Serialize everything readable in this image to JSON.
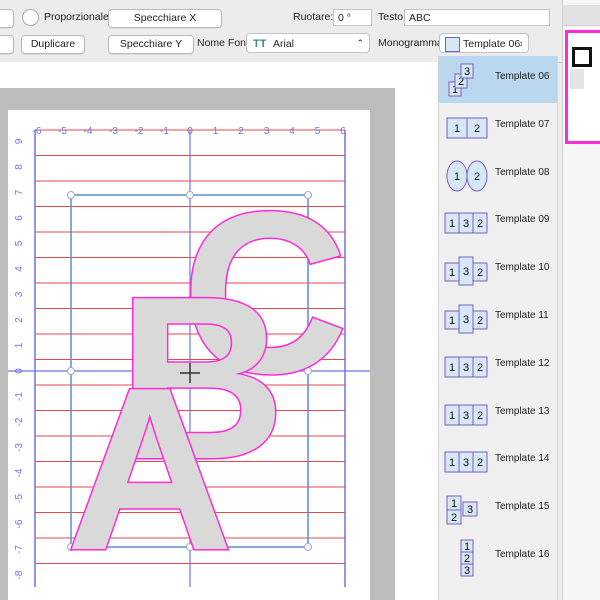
{
  "toolbar": {
    "proportional_label": "Proporzionale",
    "mirror_x_label": "Specchiare X",
    "rotate_label": "Ruotare:",
    "rotate_value": "0 °",
    "text_label": "Testo",
    "text_value": "ABC",
    "duplicate_label": "Duplicare",
    "mirror_y_label": "Specchiare Y",
    "font_label": "Nome Font",
    "font_value": "Arial",
    "monogram_label": "Monogramma",
    "monogram_value": "Template 06"
  },
  "ruler": {
    "x_ticks": [
      "-6",
      "-5",
      "-4",
      "-3",
      "-2",
      "-1",
      "0",
      "1",
      "2",
      "3",
      "4",
      "5",
      "6"
    ],
    "y_ticks": [
      "9",
      "8",
      "7",
      "6",
      "5",
      "4",
      "3",
      "2",
      "1",
      "0",
      "-1",
      "-2",
      "-3",
      "-4",
      "-5",
      "-6",
      "-7",
      "-8"
    ]
  },
  "monogram_letters": {
    "a": "A",
    "b": "B",
    "c": "C"
  },
  "templates": [
    {
      "label": "Template 06",
      "icon": "stacked-diagonal-icon",
      "glyphs": [
        "1",
        "2",
        "3"
      ],
      "selected": true
    },
    {
      "label": "Template 07",
      "icon": "hourglass-pair-icon",
      "glyphs": [
        "1",
        "2"
      ]
    },
    {
      "label": "Template 08",
      "icon": "oval-pair-icon",
      "glyphs": [
        "1",
        "2"
      ]
    },
    {
      "label": "Template 09",
      "icon": "triple-box-icon",
      "glyphs": [
        "1",
        "3",
        "2"
      ]
    },
    {
      "label": "Template 10",
      "icon": "triple-center-tall-icon",
      "glyphs": [
        "1",
        "3",
        "2"
      ]
    },
    {
      "label": "Template 11",
      "icon": "triple-center-tall-icon",
      "glyphs": [
        "1",
        "3",
        "2"
      ]
    },
    {
      "label": "Template 12",
      "icon": "triple-bracket-icon",
      "glyphs": [
        "1",
        "3",
        "2"
      ]
    },
    {
      "label": "Template 13",
      "icon": "triple-diamond-icon",
      "glyphs": [
        "1",
        "3",
        "2"
      ]
    },
    {
      "label": "Template 14",
      "icon": "triple-arrow-icon",
      "glyphs": [
        "1",
        "3",
        "2"
      ]
    },
    {
      "label": "Template 15",
      "icon": "stacked-left-icon",
      "glyphs": [
        "1",
        "2",
        "3"
      ]
    },
    {
      "label": "Template 16",
      "icon": "vertical-stack-icon",
      "glyphs": [
        "1",
        "2",
        "3"
      ]
    }
  ],
  "right_panel": {
    "index": "1"
  },
  "colors": {
    "accent": "#ff2bd6",
    "grid_red": "#e8474b",
    "grid_blue": "#6d74e8",
    "selection": "#b9d7ee"
  }
}
